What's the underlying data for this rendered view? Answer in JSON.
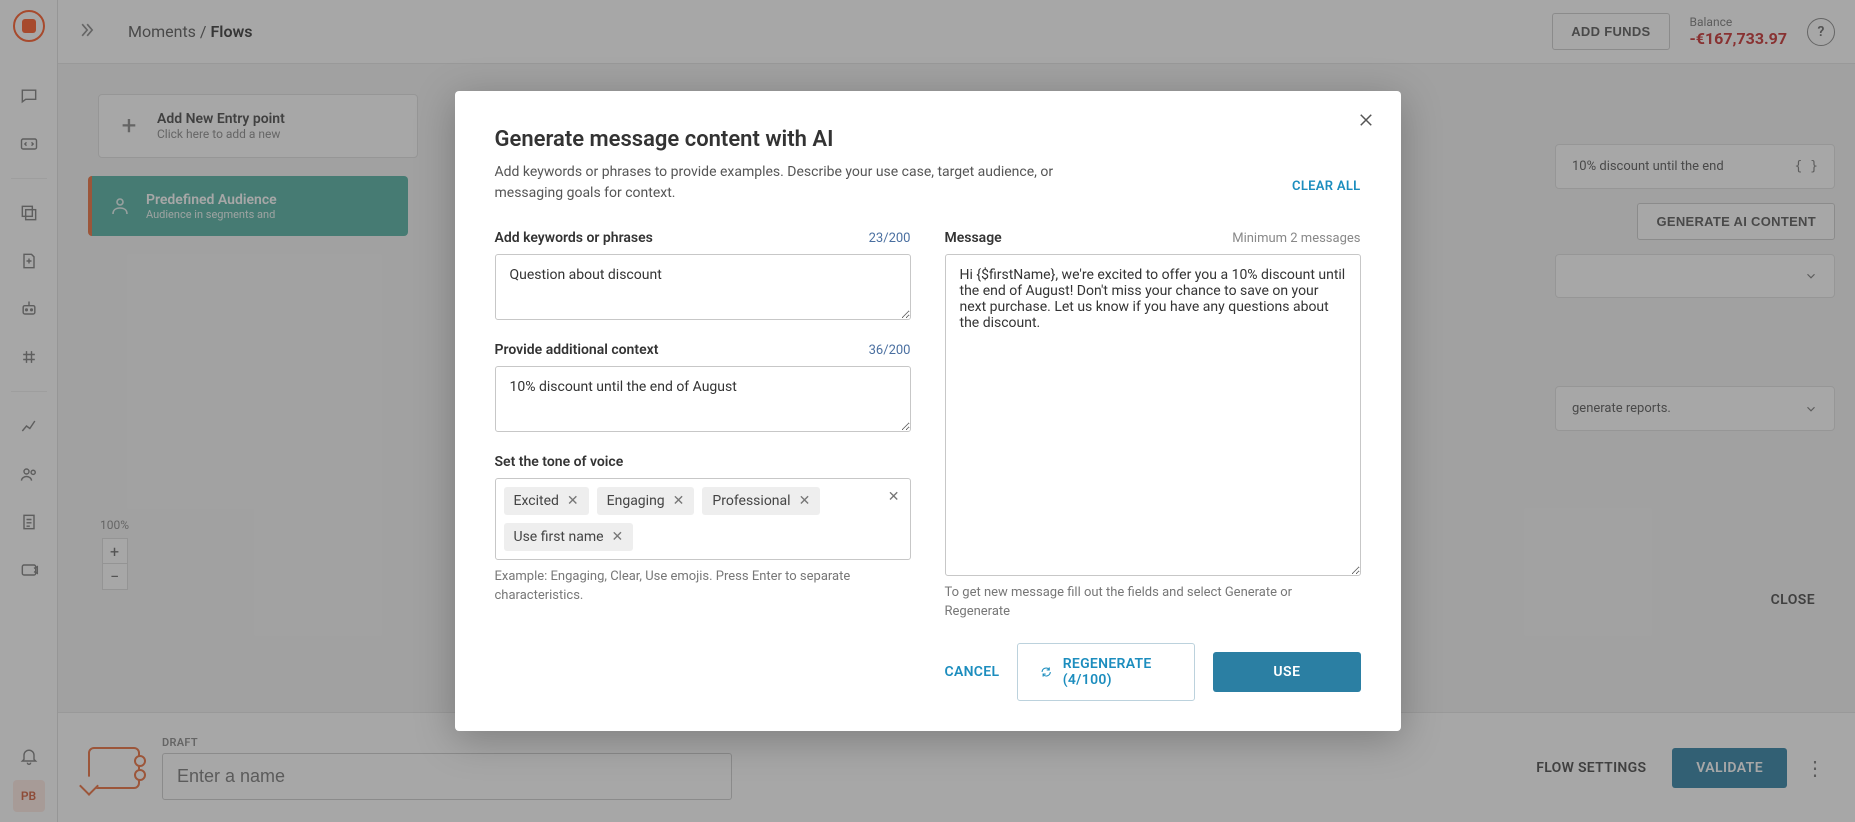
{
  "rail": {
    "avatar_initials": "PB"
  },
  "topbar": {
    "breadcrumb_root": "Moments",
    "breadcrumb_sep": " / ",
    "breadcrumb_current": "Flows",
    "add_funds": "ADD FUNDS",
    "balance_label": "Balance",
    "balance_value": "-€167,733.97"
  },
  "canvas": {
    "entry_title": "Add New Entry point",
    "entry_sub": "Click here to add a new",
    "audience_title": "Predefined Audience",
    "audience_sub": "Audience in segments and",
    "zoom_percent": "100%",
    "rp_discount_text": "10% discount until the end",
    "rp_generate_btn": "GENERATE AI CONTENT",
    "rp_reports_text": "generate reports.",
    "close_text": "CLOSE"
  },
  "bottom": {
    "draft_label": "DRAFT",
    "name_placeholder": "Enter a name",
    "flow_settings": "FLOW SETTINGS",
    "validate": "VALIDATE"
  },
  "modal": {
    "title": "Generate message content with AI",
    "subtitle": "Add keywords or phrases to provide examples. Describe your use case, target audience, or messaging goals for context.",
    "clear_all": "CLEAR ALL",
    "keywords_label": "Add keywords or phrases",
    "keywords_count": "23/200",
    "keywords_value": "Question about discount",
    "context_label": "Provide additional context",
    "context_count": "36/200",
    "context_value": "10% discount until the end of August",
    "tone_label": "Set the tone of voice",
    "tone_chips": [
      "Excited",
      "Engaging",
      "Professional",
      "Use first name"
    ],
    "tone_help": "Example: Engaging, Clear, Use emojis. Press Enter to separate characteristics.",
    "message_label": "Message",
    "message_hint": "Minimum 2 messages",
    "message_value": "Hi {$firstName}, we're excited to offer you a 10% discount until the end of August! Don't miss your chance to save on your next purchase. Let us know if you have any questions about the discount.",
    "message_help": "To get new message fill out the fields and select Generate or Regenerate",
    "cancel": "CANCEL",
    "regenerate": "REGENERATE (4/100)",
    "use": "USE"
  }
}
